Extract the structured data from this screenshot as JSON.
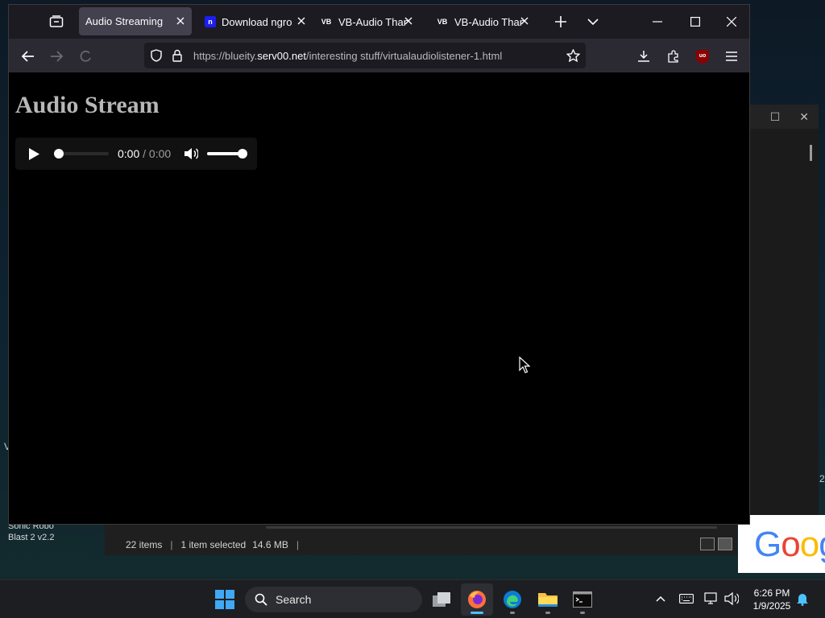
{
  "desktop": {
    "icon_label": "Sonic Robo Blast 2 v2.2",
    "edge_text": "V",
    "edge_number": "2",
    "google_logo_text": "Goog"
  },
  "explorer": {
    "item_count": "22 items",
    "selection": "1 item selected",
    "selection_size": "14.6 MB"
  },
  "browser": {
    "tabs": [
      {
        "title": "Audio Streaming",
        "active": true,
        "favicon": ""
      },
      {
        "title": "Download ngrok",
        "active": false,
        "favicon": "n"
      },
      {
        "title": "VB-Audio Thank",
        "active": false,
        "favicon": "VB"
      },
      {
        "title": "VB-Audio Thank",
        "active": false,
        "favicon": "VB"
      }
    ],
    "url": {
      "prefix": "https://blueity.",
      "host": "serv00.net",
      "path": "/interesting stuff/virtualaudiolistener-1.html"
    },
    "extension_badge": "uo"
  },
  "page": {
    "heading": "Audio Stream",
    "player": {
      "current_time": "0:00",
      "separator": " / ",
      "duration": "0:00",
      "progress": 0,
      "volume": 1.0
    }
  },
  "taskbar": {
    "search_label": "Search",
    "apps": [
      "windows-start",
      "task-view",
      "firefox",
      "edge",
      "file-explorer",
      "terminal"
    ],
    "clock_time": "6:26 PM",
    "clock_date": "1/9/2025"
  },
  "colors": {
    "tab_active_bg": "#42414d",
    "tabbar_bg": "#1c1b22",
    "navbar_bg": "#2b2a33",
    "accent": "#4cc2ff"
  }
}
